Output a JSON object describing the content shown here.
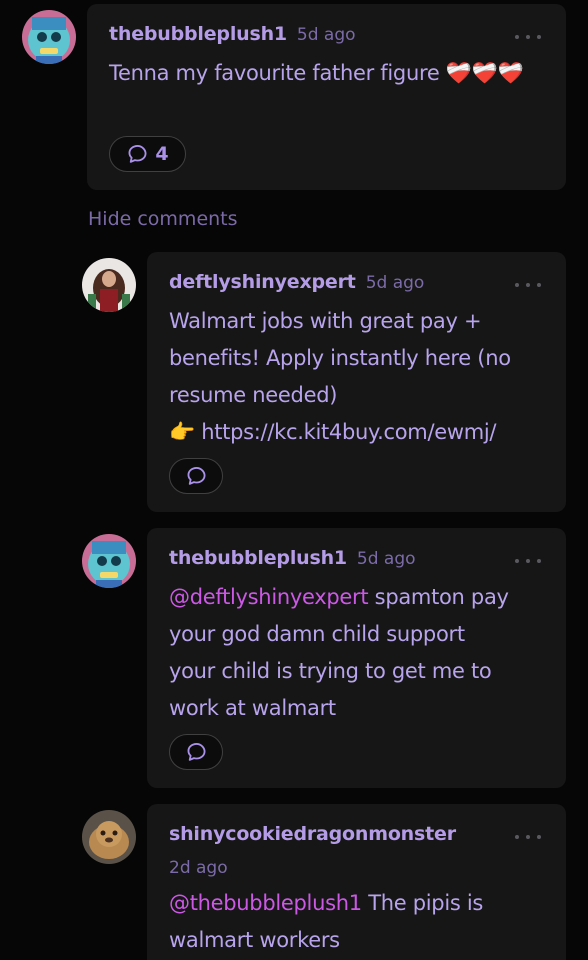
{
  "theme": {
    "background": "#060606",
    "card_background": "#161616",
    "username_color": "#b49ce6",
    "text_color": "#b8a4ec",
    "mention_color": "#cc59e6",
    "muted_color": "#7b6ba8"
  },
  "top_comment": {
    "username": "thebubbleplush1",
    "time": "5d ago",
    "text": "Tenna my favourite father figure ❤️‍🩹❤️‍🩹❤️‍🩹",
    "reply_count": "4"
  },
  "hide_comments_label": "Hide comments",
  "replies": [
    {
      "username": "deftlyshinyexpert",
      "time": "5d ago",
      "line1": "Walmart jobs with great pay +",
      "line2": "benefits! Apply instantly here (no",
      "line3": "resume needed)",
      "line4": "👉 https://kc.kit4buy.com/ewmj/"
    },
    {
      "username": "thebubbleplush1",
      "time": "5d ago",
      "mention": "@deftlyshinyexpert",
      "line1_rest": " spamton pay",
      "line2": "your god damn child support",
      "line3": "your child is trying to get me to",
      "line4": "work at walmart"
    },
    {
      "username": "shinycookiedragonmonster",
      "time": "2d ago",
      "mention": "@thebubbleplush1",
      "line1_rest": " The pipis is",
      "line2": "walmart workers"
    }
  ]
}
